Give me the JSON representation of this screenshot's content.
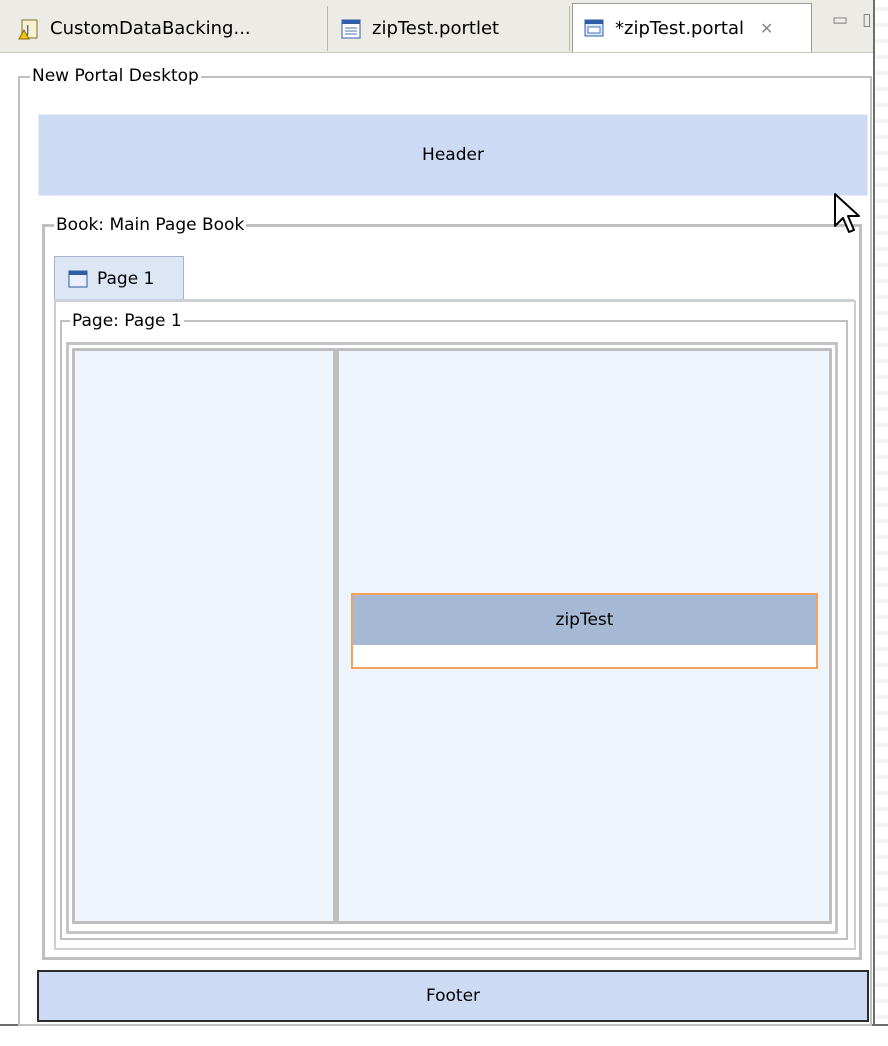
{
  "tabs": [
    {
      "label": "CustomDataBacking...",
      "icon": "java-file-warning-icon",
      "active": false
    },
    {
      "label": "zipTest.portlet",
      "icon": "portlet-file-icon",
      "active": false
    },
    {
      "label": "*zipTest.portal",
      "icon": "portal-file-icon",
      "active": true,
      "close_icon": "close-x-icon"
    }
  ],
  "view_controls": {
    "minimize_glyph": "▭",
    "maximize_glyph": "▯"
  },
  "desktop": {
    "legend": "New Portal Desktop",
    "header": "Header",
    "footer": "Footer"
  },
  "book": {
    "legend": "Book: Main Page Book",
    "tabs": [
      {
        "label": "Page 1",
        "icon": "page-icon"
      }
    ]
  },
  "page": {
    "legend": "Page: Page 1",
    "portlet_title": "zipTest"
  },
  "colors": {
    "header_bg": "#ccdaf4",
    "column_bg": "#eef4fc",
    "portlet_title_bg": "#a5b8d4",
    "portlet_selection": "#f2a25b"
  }
}
